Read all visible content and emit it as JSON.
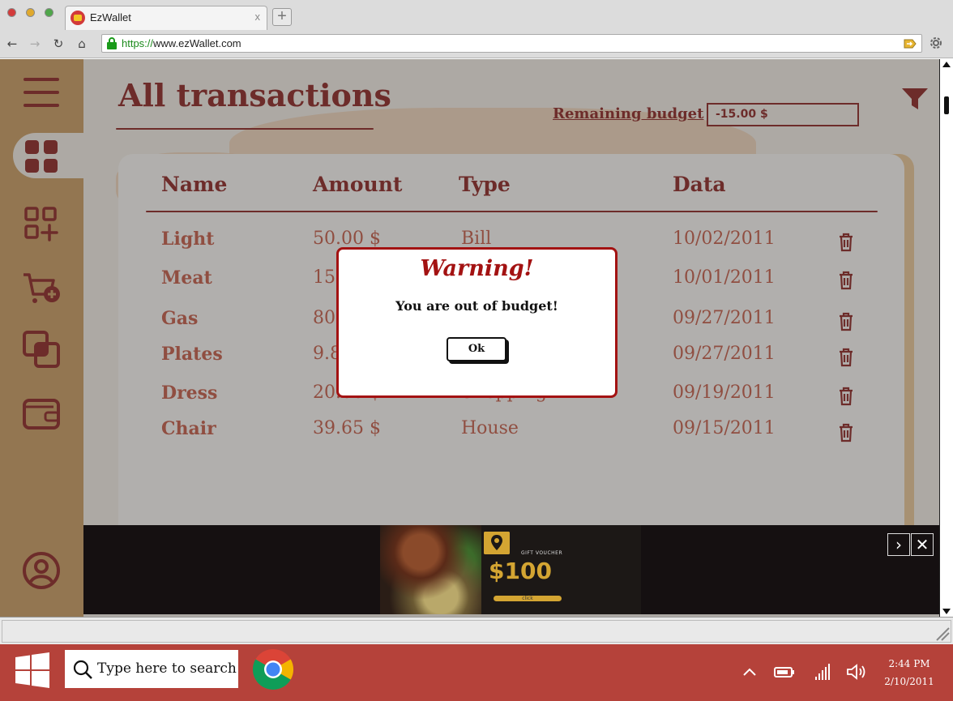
{
  "browser": {
    "tab_title": "EzWallet",
    "tab_close": "x",
    "url_protocol": "https://",
    "url_rest": "www.ezWallet.com"
  },
  "page": {
    "title": "All transactions",
    "budget_label": "Remaining budget",
    "budget_value": "-15.00 $"
  },
  "table": {
    "headers": [
      "Name",
      "Amount",
      "Type",
      "Data"
    ],
    "rows": [
      {
        "name": "Light",
        "amount": "50.00 $",
        "type": "Bill",
        "date": "10/02/2011"
      },
      {
        "name": "Meat",
        "amount": "15.",
        "type": "",
        "date": "10/01/2011"
      },
      {
        "name": "Gas",
        "amount": "80",
        "type": "",
        "date": "09/27/2011"
      },
      {
        "name": "Plates",
        "amount": "9.8",
        "type": "",
        "date": "09/27/2011"
      },
      {
        "name": "Dress",
        "amount": "20.00 $",
        "type": "Shopping",
        "date": "09/19/2011"
      },
      {
        "name": "Chair",
        "amount": "39.65 $",
        "type": "House",
        "date": "09/15/2011"
      }
    ]
  },
  "modal": {
    "title": "Warning!",
    "message": "You are out of budget!",
    "ok_label": "Ok"
  },
  "ad": {
    "small_text": "GIFT VOUCHER",
    "amount": "$100",
    "cta": "click"
  },
  "taskbar": {
    "search_placeholder": "Type here to search",
    "time": "2:44 PM",
    "date": "2/10/2011"
  },
  "colors": {
    "brand": "#8b2320",
    "sidebar": "#c89a5e",
    "cell_text": "#c35a45",
    "modal_border": "#a31212",
    "taskbar": "#b5423a"
  }
}
